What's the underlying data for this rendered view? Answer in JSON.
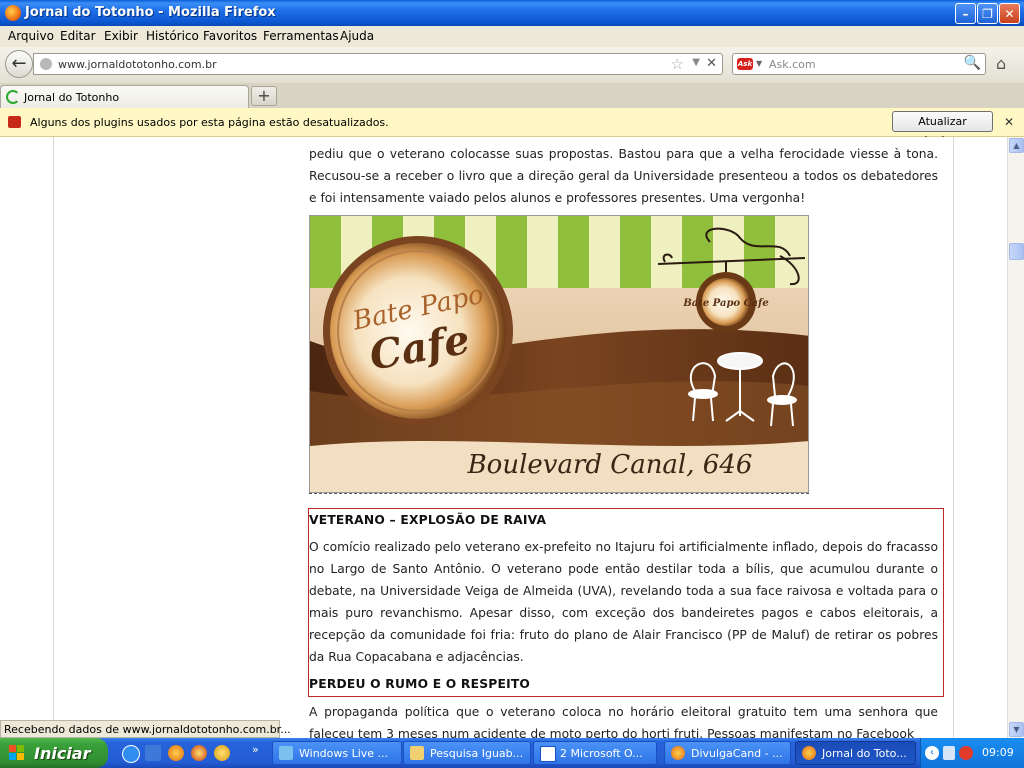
{
  "window": {
    "title": "Jornal do Totonho - Mozilla Firefox"
  },
  "menu": [
    "Arquivo",
    "Editar",
    "Exibir",
    "Histórico",
    "Favoritos",
    "Ferramentas",
    "Ajuda"
  ],
  "nav": {
    "url": "www.jornaldototonho.com.br",
    "search_placeholder": "Ask.com",
    "search_engine": "Ask"
  },
  "tabs": [
    {
      "label": "Jornal do Totonho"
    }
  ],
  "plugin_notice": {
    "text": "Alguns dos plugins usados por esta página estão desatualizados.",
    "button": "Atualizar plugins..."
  },
  "article": {
    "intro": "pediu que o veterano colocasse suas propostas. Bastou para que a velha ferocidade viesse à tona. Recusou-se a receber o livro que a direção geral da Universidade presenteou a todos os debatedores e foi intensamente vaiado pelos alunos e professores presentes. Uma vergonha!",
    "ad": {
      "brand_line1": "Bate Papo",
      "brand_line2": "Cafe",
      "sign": "Bate Papo Cafe",
      "address": "Boulevard Canal, 646"
    },
    "section1_title": "VETERANO – EXPLOSÃO DE RAIVA",
    "section1_text": "O comício realizado pelo veterano ex-prefeito no Itajuru foi artificialmente inflado, depois do fracasso no Largo de Santo Antônio. O veterano pode então destilar toda a bílis, que acumulou durante o debate, na Universidade Veiga de Almeida (UVA), revelando toda a sua face raivosa e voltada para o mais puro revanchismo. Apesar disso, com exceção dos bandeiretes pagos e cabos eleitorais, a recepção da comunidade foi fria: fruto do plano de Alair Francisco (PP de Maluf) de retirar os pobres da Rua Copacabana e adjacências.",
    "section2_title": "PERDEU O RUMO E O RESPEITO",
    "section2_text": "A propaganda política que o veterano coloca no horário eleitoral gratuito tem uma senhora que faleceu tem 3 meses num acidente de moto perto do horti fruti. Pessoas manifestam no Facebook"
  },
  "status": "Recebendo dados de www.jornaldototonho.com.br...",
  "taskbar": {
    "start": "Iniciar",
    "tasks": [
      "Windows Live ...",
      "Pesquisa Iguab...",
      "2 Microsoft O...",
      "DivulgaCand - ...",
      "Jornal do Toto..."
    ],
    "clock": "09:09"
  },
  "colors": {
    "accent_red": "#c0292a",
    "titlebar_blue": "#0b56d0",
    "start_green": "#3aa13a"
  }
}
